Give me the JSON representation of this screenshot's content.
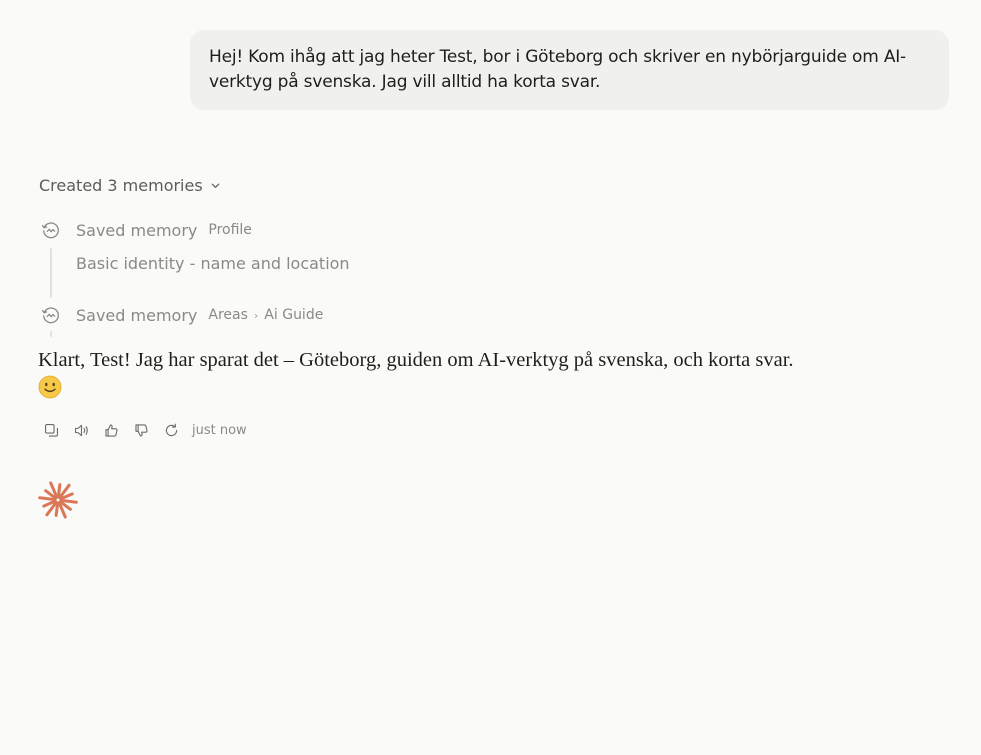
{
  "conversation": {
    "user_message": "Hej! Kom ihåg att jag heter Test, bor i Göteborg och skriver en nybörjarguide om AI-verktyg på svenska. Jag vill alltid ha korta svar.",
    "memories": {
      "summary_label": "Created 3 memories",
      "items": [
        {
          "title": "Saved memory",
          "tag": "Profile",
          "description": "Basic identity - name and location",
          "icon": "memory-icon"
        },
        {
          "title": "Saved memory",
          "breadcrumb": [
            "Areas",
            "Ai Guide"
          ],
          "icon": "memory-icon"
        }
      ]
    },
    "assistant_message": "Klart, Test! Jag har sparat det – Göteborg, guiden om AI-verktyg på svenska, och korta svar.",
    "assistant_emoji": "🙂",
    "actions": {
      "timestamp": "just now",
      "buttons": [
        "copy-icon",
        "speaker-icon",
        "thumbs-up-icon",
        "thumbs-down-icon",
        "retry-icon"
      ]
    },
    "spark_icon": "claude-spark-icon",
    "accent_color": "#d97757"
  }
}
